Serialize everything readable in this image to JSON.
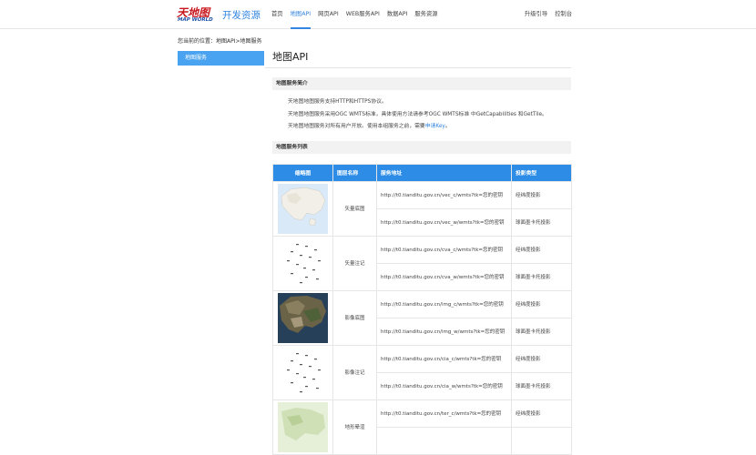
{
  "header": {
    "logo_cn": "天地图",
    "logo_en": "MAP WORLD",
    "site_title": "开发资源",
    "nav": [
      {
        "label": "首页",
        "active": false
      },
      {
        "label": "地图API",
        "active": true
      },
      {
        "label": "网页API",
        "active": false
      },
      {
        "label": "WEB服务API",
        "active": false
      },
      {
        "label": "数据API",
        "active": false
      },
      {
        "label": "服务资源",
        "active": false
      }
    ],
    "nav_right": [
      {
        "label": "升级引导"
      },
      {
        "label": "控制台"
      }
    ]
  },
  "breadcrumb": "您当前的位置：地图API>地图服务",
  "sidebar": {
    "items": [
      {
        "label": "地图服务",
        "active": true
      }
    ]
  },
  "main": {
    "title": "地图API",
    "intro_section": "地图服务简介",
    "intro_lines": [
      "天地图地图服务支持HTTP和HTTPS协议。",
      "天地图地图服务采用OGC WMTS标准，具体使用方法请参考OGC WMTS标准 中GetCapabilities 和GetTile。",
      "天地图地图服务对所有用户开放。使用本组服务之前，需要"
    ],
    "intro_link": "申请Key",
    "intro_link_tail": "。",
    "list_section": "地图服务列表",
    "table": {
      "headers": [
        "缩略图",
        "图层名称",
        "服务地址",
        "投影类型"
      ],
      "rows": [
        {
          "thumb": "vec",
          "layer": "矢量底图",
          "entries": [
            {
              "url": "http://t0.tianditu.gov.cn/vec_c/wmts?tk=您的密钥",
              "proj": "经纬度投影"
            },
            {
              "url": "http://t0.tianditu.gov.cn/vec_w/wmts?tk=您的密钥",
              "proj": "球面墨卡托投影"
            }
          ]
        },
        {
          "thumb": "cva",
          "layer": "矢量注记",
          "entries": [
            {
              "url": "http://t0.tianditu.gov.cn/cva_c/wmts?tk=您的密钥",
              "proj": "经纬度投影"
            },
            {
              "url": "http://t0.tianditu.gov.cn/cva_w/wmts?tk=您的密钥",
              "proj": "球面墨卡托投影"
            }
          ]
        },
        {
          "thumb": "img",
          "layer": "影像底图",
          "entries": [
            {
              "url": "http://t0.tianditu.gov.cn/img_c/wmts?tk=您的密钥",
              "proj": "经纬度投影"
            },
            {
              "url": "http://t0.tianditu.gov.cn/img_w/wmts?tk=您的密钥",
              "proj": "球面墨卡托投影"
            }
          ]
        },
        {
          "thumb": "cia",
          "layer": "影像注记",
          "entries": [
            {
              "url": "http://t0.tianditu.gov.cn/cia_c/wmts?tk=您的密钥",
              "proj": "经纬度投影"
            },
            {
              "url": "http://t0.tianditu.gov.cn/cia_w/wmts?tk=您的密钥",
              "proj": "球面墨卡托投影"
            }
          ]
        },
        {
          "thumb": "ter",
          "layer": "地形晕渲",
          "entries": [
            {
              "url": "http://t0.tianditu.gov.cn/ter_c/wmts?tk=您的密钥",
              "proj": "经纬度投影"
            },
            {
              "url": "",
              "proj": ""
            }
          ]
        }
      ]
    }
  },
  "colors": {
    "accent": "#3385e0",
    "table_header": "#2c8ce6",
    "sidebar_active": "#4aa3f0",
    "logo_red": "#c8161d"
  }
}
